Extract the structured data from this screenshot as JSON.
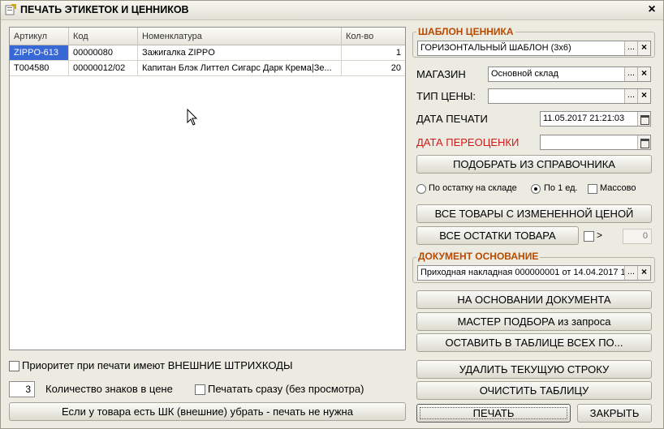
{
  "window": {
    "title": "ПЕЧАТЬ ЭТИКЕТОК И ЦЕННИКОВ"
  },
  "table": {
    "headers": [
      "Артикул",
      "Код",
      "Номенклатура",
      "Кол-во"
    ],
    "rows": [
      {
        "article": "ZIPPO-613",
        "code": "00000080",
        "name": "Зажигалка ZIPPO",
        "qty": "1"
      },
      {
        "article": "T004580",
        "code": "00000012/02",
        "name": "Капитан Блэк Литтел Сигарс Дарк Крема|Зе...",
        "qty": "20"
      }
    ]
  },
  "options": {
    "priority_label": "Приоритет при печати имеют ВНЕШНИЕ ШТРИХКОДЫ",
    "digits_value": "3",
    "digits_label": "Количество знаков в цене",
    "print_now_label": "Печатать сразу (без просмотра)",
    "remove_barcode_button": "Если у товара есть ШК (внешние) убрать - печать не нужна"
  },
  "template_group": {
    "title": "ШАБЛОН ЦЕННИКА",
    "value": "ГОРИЗОНТАЛЬНЫЙ ШАБЛОН (3x6)"
  },
  "store": {
    "label": "МАГАЗИН",
    "value": "Основной склад"
  },
  "price_type": {
    "label": "ТИП ЦЕНЫ:",
    "value": ""
  },
  "print_date": {
    "label": "ДАТА ПЕЧАТИ",
    "value": "11.05.2017 21:21:03"
  },
  "reprice_date": {
    "label": "ДАТА ПЕРЕОЦЕНКИ",
    "value": "  .  .          :  :"
  },
  "pick_button": "ПОДОБРАТЬ ИЗ СПРАВОЧНИКА",
  "radios": {
    "by_stock": "По остатку на складе",
    "by_one": "По 1 ед.",
    "bulk": "Массово"
  },
  "changed_price_button": "ВСЕ ТОВАРЫ С ИЗМЕНЕННОЙ ЦЕНОЙ",
  "all_stock_button": "ВСЕ ОСТАТКИ ТОВАРА",
  "greater_label": ">",
  "greater_value": "0",
  "doc_group": {
    "title": "ДОКУМЕНТ ОСНОВАНИЕ",
    "value": "Приходная накладная 000000001 от 14.04.2017 1..."
  },
  "buttons": {
    "by_document": "НА ОСНОВАНИИ ДОКУМЕНТА",
    "wizard": "МАСТЕР ПОДБОРА из запроса",
    "leave_all": "ОСТАВИТЬ В ТАБЛИЦЕ ВСЕХ ПО...",
    "delete_row": "УДАЛИТЬ ТЕКУЩУЮ СТРОКУ",
    "clear_table": "ОЧИСТИТЬ ТАБЛИЦУ",
    "print": "ПЕЧАТЬ",
    "close": "ЗАКРЫТЬ"
  },
  "icons": {
    "select": "...",
    "clear": "×",
    "close": "×"
  },
  "colors": {
    "selection": "#3867d6",
    "group_title": "#b84a00",
    "required_label": "#d11a1a"
  }
}
